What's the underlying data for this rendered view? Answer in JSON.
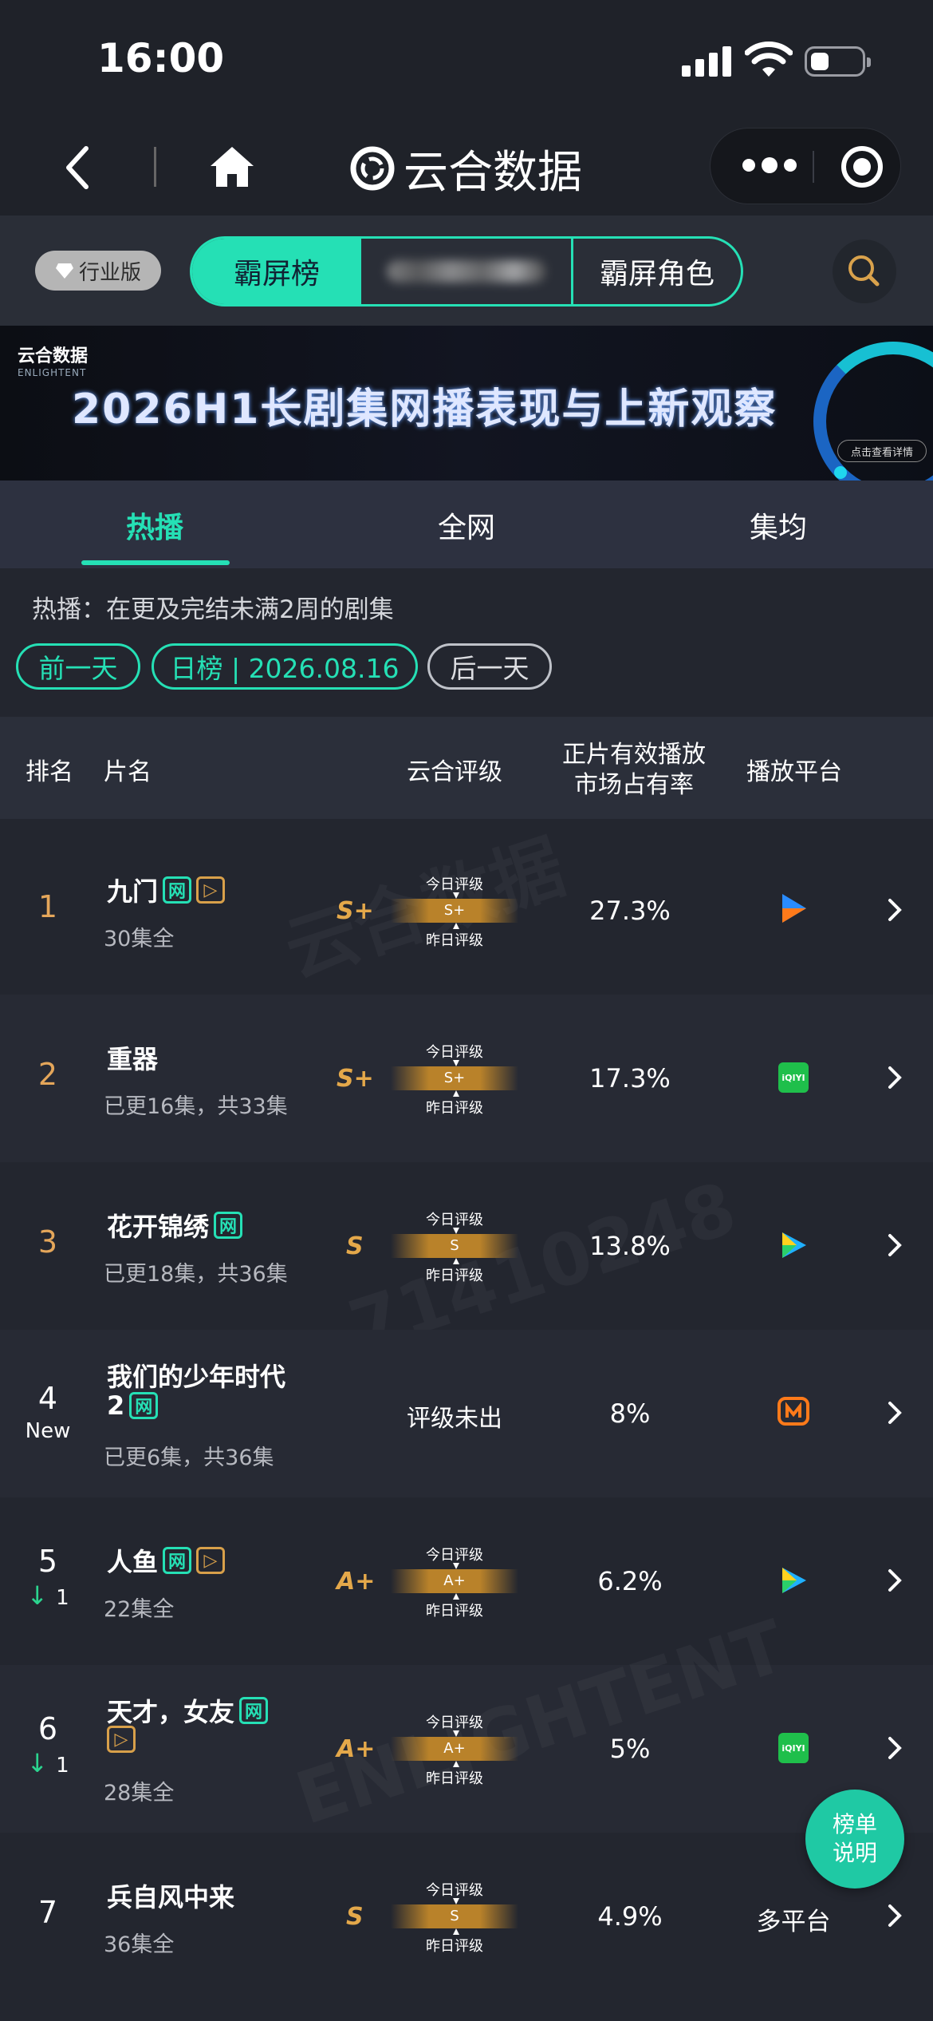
{
  "status": {
    "time": "16:00"
  },
  "nav": {
    "title": "云合数据"
  },
  "toolbar": {
    "edition": "行业版",
    "segments": [
      "霸屏榜",
      "",
      "霸屏角色"
    ]
  },
  "banner": {
    "logo_cn": "云合数据",
    "logo_en": "ENLIGHTENT",
    "title": "2026H1长剧集网播表现与上新观察",
    "button": "点击查看详情"
  },
  "tabs": [
    "热播",
    "全网",
    "集均"
  ],
  "hint": "热播：在更及完结未满2周的剧集",
  "date": {
    "prev": "前一天",
    "current": "日榜 | 2026.08.16",
    "next": "后一天"
  },
  "table": {
    "headers": {
      "rank": "排名",
      "name": "片名",
      "grade": "云合评级",
      "share_l1": "正片有效播放",
      "share_l2": "市场占有率",
      "platform": "播放平台"
    },
    "gauge_top": "今日评级",
    "gauge_bottom": "昨日评级",
    "rows": [
      {
        "rank": "1",
        "trend": "",
        "title": "九门",
        "tags": [
          "网",
          "▷"
        ],
        "sub": "30集全",
        "grade": "S+",
        "share": "27.3%",
        "platform": "tencent"
      },
      {
        "rank": "2",
        "trend": "",
        "title": "重器",
        "tags": [],
        "sub": "已更16集，共33集",
        "grade": "S+",
        "share": "17.3%",
        "platform": "iqiyi"
      },
      {
        "rank": "3",
        "trend": "",
        "title": "花开锦绣",
        "tags": [
          "网"
        ],
        "sub": "已更18集，共36集",
        "grade": "S",
        "share": "13.8%",
        "platform": "youku"
      },
      {
        "rank": "4",
        "rank_sub": "New",
        "title_l1": "我们的少年时代",
        "title_l2": "2",
        "tags": [
          "网"
        ],
        "sub": "已更6集，共36集",
        "grade_pending": "评级未出",
        "share": "8%",
        "platform": "mango"
      },
      {
        "rank": "5",
        "trend": "1",
        "title": "人鱼",
        "tags": [
          "网",
          "▷"
        ],
        "sub": "22集全",
        "grade": "A+",
        "share": "6.2%",
        "platform": "youku"
      },
      {
        "rank": "6",
        "trend": "1",
        "title": "天才，女友",
        "tags": [
          "网",
          "▷"
        ],
        "sub": "28集全",
        "grade": "A+",
        "share": "5%",
        "platform": "iqiyi"
      },
      {
        "rank": "7",
        "trend": "",
        "title": "兵自风中来",
        "tags": [],
        "sub": "36集全",
        "grade": "S",
        "share": "4.9%",
        "platform_text": "多平台"
      }
    ]
  },
  "fab": {
    "line1": "榜单",
    "line2": "说明"
  },
  "colors": {
    "accent": "#25e0b5",
    "gold": "#e4a84a",
    "bg": "#23262f"
  },
  "watermarks": [
    "云合数据",
    "ENLIGHTENT",
    "71410248"
  ]
}
